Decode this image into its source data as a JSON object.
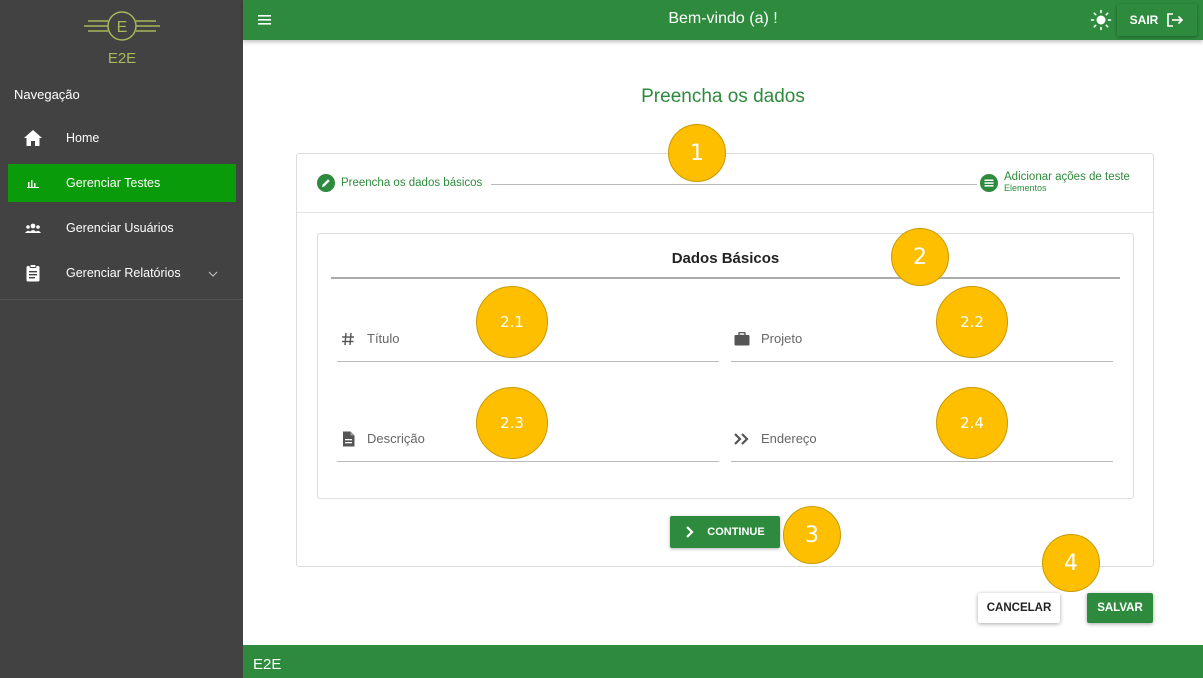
{
  "sidebar": {
    "logo_letter": "E",
    "logo_text": "E2E",
    "heading": "Navegação",
    "items": [
      {
        "label": "Home",
        "icon": "home-icon"
      },
      {
        "label": "Gerenciar Testes",
        "icon": "chart-icon",
        "active": true
      },
      {
        "label": "Gerenciar Usuários",
        "icon": "users-icon"
      },
      {
        "label": "Gerenciar Relatórios",
        "icon": "clipboard-icon",
        "has_submenu": true
      }
    ]
  },
  "header": {
    "title": "Bem-vindo (a) !",
    "logout_label": "SAIR"
  },
  "main": {
    "title": "Preencha os dados",
    "stepper": {
      "step1": "Preencha os dados básicos",
      "step2": "Adicionar ações de teste",
      "step2_sub": "Elementos"
    },
    "section_title": "Dados Básicos",
    "fields": {
      "titulo": {
        "label": "Título",
        "icon": "hash-icon"
      },
      "projeto": {
        "label": "Projeto",
        "icon": "briefcase-icon"
      },
      "descricao": {
        "label": "Descrição",
        "icon": "document-icon"
      },
      "endereco": {
        "label": "Endereço",
        "icon": "double-chevron-icon"
      }
    },
    "continue_label": "CONTINUE",
    "cancel_label": "CANCELAR",
    "save_label": "SALVAR"
  },
  "footer": {
    "text": "E2E"
  },
  "markers": {
    "m1": "1",
    "m2": "2",
    "m21": "2.1",
    "m22": "2.2",
    "m23": "2.3",
    "m24": "2.4",
    "m3": "3",
    "m4": "4"
  },
  "colors": {
    "primary": "#2e8b3d",
    "sidebar_bg": "#424242",
    "active_item": "#0a9b0a",
    "marker": "#fdbf00"
  }
}
